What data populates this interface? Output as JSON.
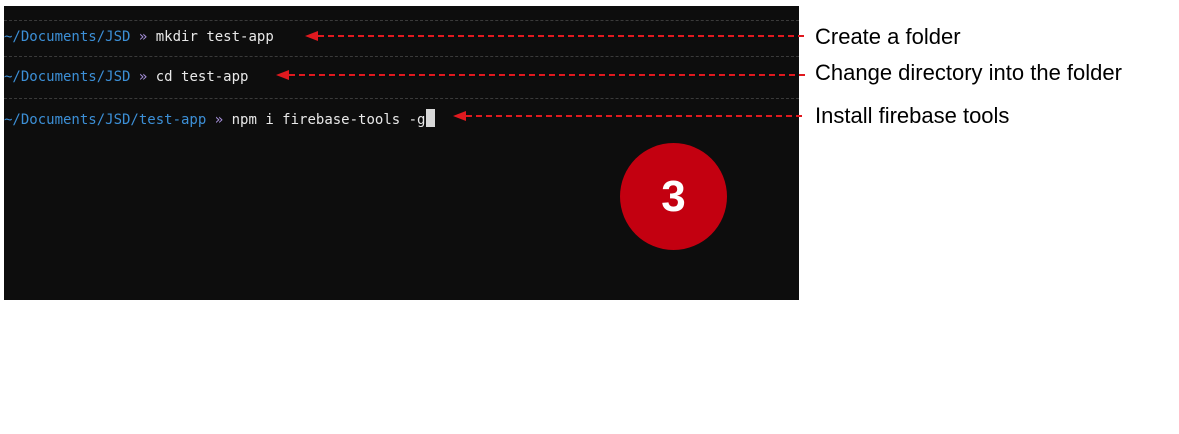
{
  "terminal": {
    "lines": [
      {
        "path": "~/Documents/JSD",
        "separator": "»",
        "command": "mkdir test-app"
      },
      {
        "path": "~/Documents/JSD",
        "separator": "»",
        "command": "cd test-app"
      },
      {
        "path": "~/Documents/JSD/test-app",
        "separator": "»",
        "command": "npm i firebase-tools -g"
      }
    ]
  },
  "annotations": [
    "Create a folder",
    "Change directory into the folder",
    "Install firebase tools"
  ],
  "step_badge": "3",
  "colors": {
    "arrow": "#e0191f",
    "badge": "#c30010",
    "path": "#3c8fd6",
    "terminal_bg": "#0d0d0d"
  }
}
